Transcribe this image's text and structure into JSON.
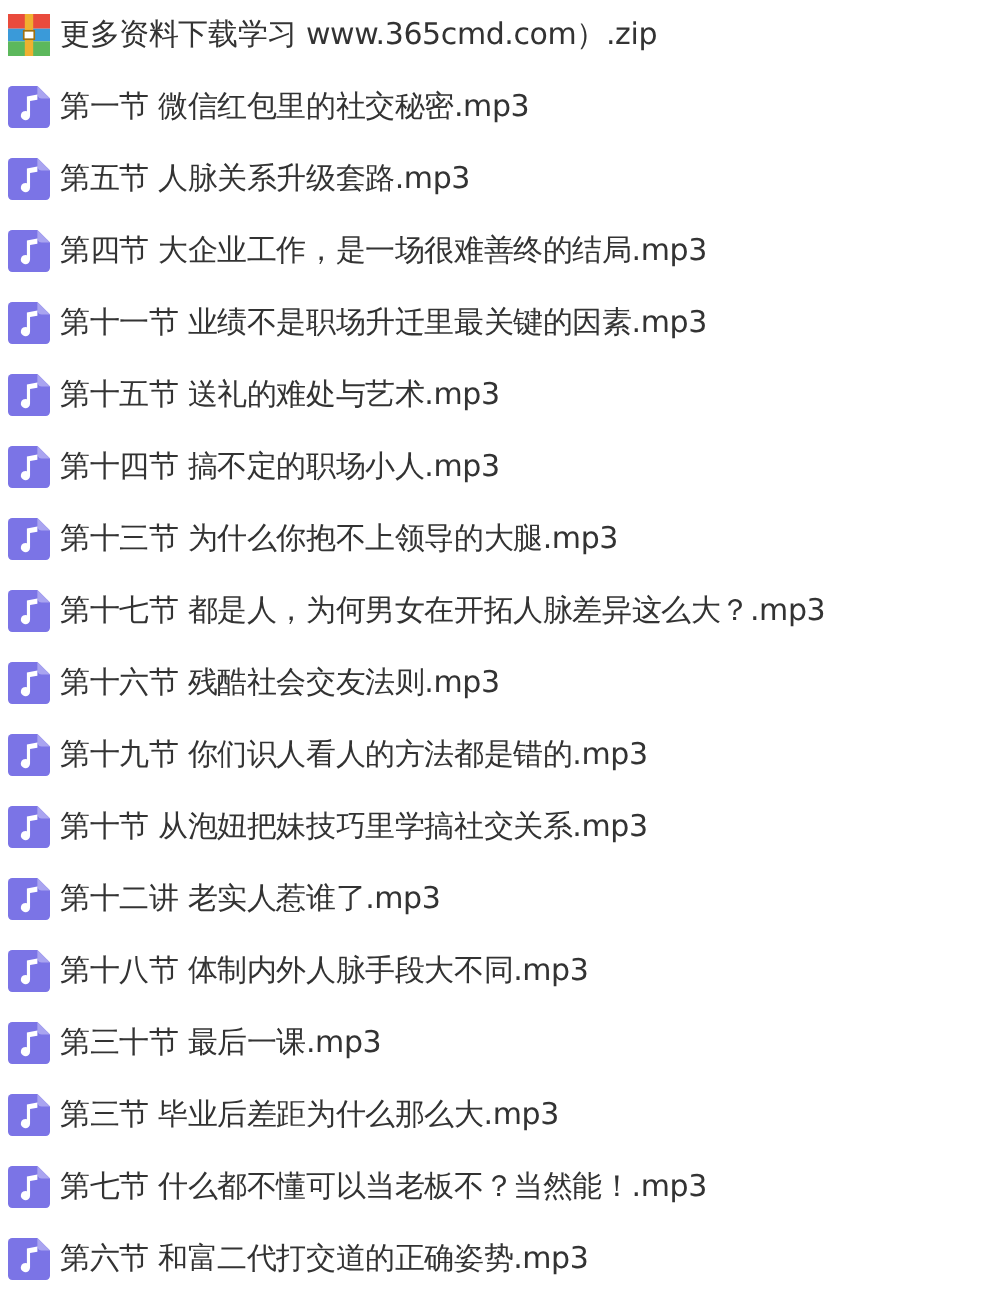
{
  "files": [
    {
      "kind": "archive",
      "name": "更多资料下载学习 www.365cmd.com）.zip"
    },
    {
      "kind": "audio",
      "name": "第一节 微信红包里的社交秘密.mp3"
    },
    {
      "kind": "audio",
      "name": "第五节 人脉关系升级套路.mp3"
    },
    {
      "kind": "audio",
      "name": "第四节 大企业工作，是一场很难善终的结局.mp3"
    },
    {
      "kind": "audio",
      "name": "第十一节 业绩不是职场升迁里最关键的因素.mp3"
    },
    {
      "kind": "audio",
      "name": "第十五节 送礼的难处与艺术.mp3"
    },
    {
      "kind": "audio",
      "name": "第十四节 搞不定的职场小人.mp3"
    },
    {
      "kind": "audio",
      "name": "第十三节 为什么你抱不上领导的大腿.mp3"
    },
    {
      "kind": "audio",
      "name": "第十七节 都是人，为何男女在开拓人脉差异这么大？.mp3"
    },
    {
      "kind": "audio",
      "name": "第十六节 残酷社会交友法则.mp3"
    },
    {
      "kind": "audio",
      "name": "第十九节 你们识人看人的方法都是错的.mp3"
    },
    {
      "kind": "audio",
      "name": "第十节 从泡妞把妹技巧里学搞社交关系.mp3"
    },
    {
      "kind": "audio",
      "name": "第十二讲 老实人惹谁了.mp3"
    },
    {
      "kind": "audio",
      "name": "第十八节 体制内外人脉手段大不同.mp3"
    },
    {
      "kind": "audio",
      "name": "第三十节 最后一课.mp3"
    },
    {
      "kind": "audio",
      "name": "第三节 毕业后差距为什么那么大.mp3"
    },
    {
      "kind": "audio",
      "name": "第七节 什么都不懂可以当老板不？当然能！.mp3"
    },
    {
      "kind": "audio",
      "name": "第六节 和富二代打交道的正确姿势.mp3"
    }
  ]
}
